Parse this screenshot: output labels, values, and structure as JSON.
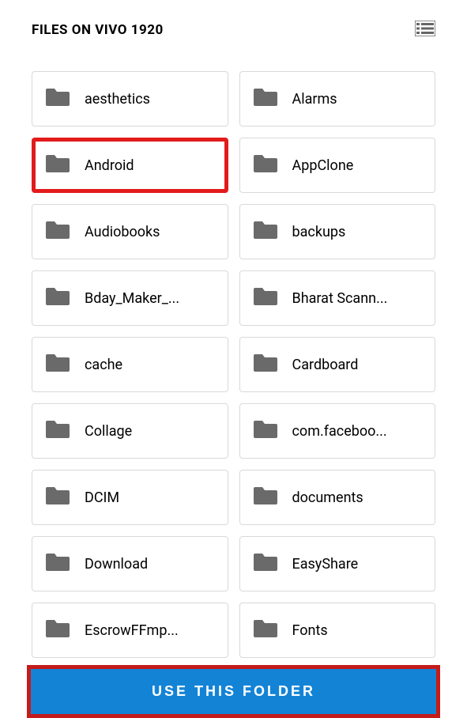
{
  "header": {
    "title": "FILES ON VIVO 1920"
  },
  "folders": [
    {
      "label": "aesthetics",
      "highlighted": false
    },
    {
      "label": "Alarms",
      "highlighted": false
    },
    {
      "label": "Android",
      "highlighted": true
    },
    {
      "label": "AppClone",
      "highlighted": false
    },
    {
      "label": "Audiobooks",
      "highlighted": false
    },
    {
      "label": "backups",
      "highlighted": false
    },
    {
      "label": "Bday_Maker_...",
      "highlighted": false
    },
    {
      "label": "Bharat Scann...",
      "highlighted": false
    },
    {
      "label": "cache",
      "highlighted": false
    },
    {
      "label": "Cardboard",
      "highlighted": false
    },
    {
      "label": "Collage",
      "highlighted": false
    },
    {
      "label": "com.faceboo...",
      "highlighted": false
    },
    {
      "label": "DCIM",
      "highlighted": false
    },
    {
      "label": "documents",
      "highlighted": false
    },
    {
      "label": "Download",
      "highlighted": false
    },
    {
      "label": "EasyShare",
      "highlighted": false
    },
    {
      "label": "EscrowFFmp...",
      "highlighted": false
    },
    {
      "label": "Fonts",
      "highlighted": false
    }
  ],
  "footer": {
    "button_label": "USE THIS FOLDER"
  }
}
